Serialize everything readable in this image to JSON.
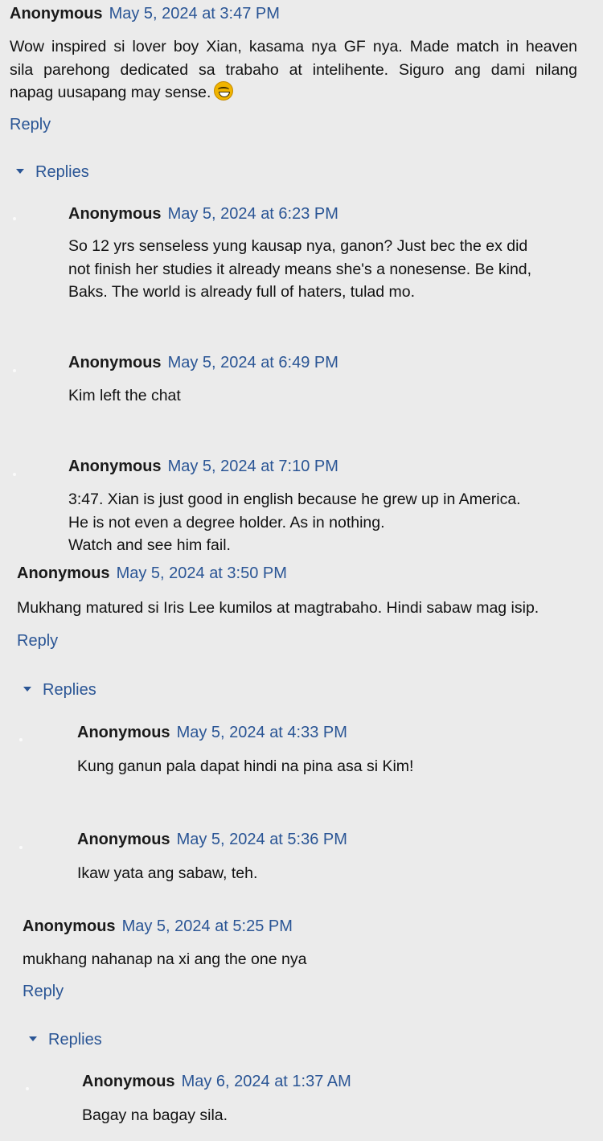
{
  "threads": [
    {
      "comment": {
        "author": "Anonymous",
        "date": "May 5, 2024 at 3:47 PM",
        "lines": [
          "Wow inspired si lover boy Xian, kasama nya GF nya. Made match in heaven",
          "sila parehong dedicated sa trabaho at intelihente. Siguro ang dami nilang",
          "napag uusapang may sense."
        ],
        "emoji": "grinning-face-emoji"
      },
      "reply_label": "Reply",
      "replies_label": "Replies",
      "replies": [
        {
          "author": "Anonymous",
          "date": "May 5, 2024 at 6:23 PM",
          "lines": [
            "So 12 yrs senseless yung kausap nya, ganon? Just bec the ex did",
            "not finish her studies it already means she's a nonesense. Be kind,",
            "Baks. The world is already full of haters, tulad mo."
          ]
        },
        {
          "author": "Anonymous",
          "date": "May 5, 2024 at 6:49 PM",
          "lines": [
            "Kim left the chat"
          ]
        },
        {
          "author": "Anonymous",
          "date": "May 5, 2024 at 7:10 PM",
          "lines": [
            "3:47. Xian is just good in english because he grew up in America.",
            "He is not even a degree holder. As in nothing.",
            "Watch and see him fail."
          ]
        }
      ]
    },
    {
      "comment": {
        "author": "Anonymous",
        "date": "May 5, 2024 at 3:50 PM",
        "lines": [
          "Mukhang matured si Iris Lee kumilos at magtrabaho. Hindi sabaw mag isip."
        ]
      },
      "reply_label": "Reply",
      "replies_label": "Replies",
      "replies": [
        {
          "author": "Anonymous",
          "date": "May 5, 2024 at 4:33 PM",
          "lines": [
            "Kung ganun pala dapat hindi na pina asa si Kim!"
          ]
        },
        {
          "author": "Anonymous",
          "date": "May 5, 2024 at 5:36 PM",
          "lines": [
            "Ikaw yata ang sabaw, teh."
          ]
        }
      ]
    },
    {
      "comment": {
        "author": "Anonymous",
        "date": "May 5, 2024 at 5:25 PM",
        "lines": [
          "mukhang nahanap na xi ang the one nya"
        ]
      },
      "reply_label": "Reply",
      "replies_label": "Replies",
      "replies": [
        {
          "author": "Anonymous",
          "date": "May 6, 2024 at 1:37 AM",
          "lines": [
            "Bagay na bagay sila."
          ]
        }
      ]
    }
  ],
  "colors": {
    "link": "#2a5595",
    "background": "#ebebeb",
    "text": "#111111"
  }
}
